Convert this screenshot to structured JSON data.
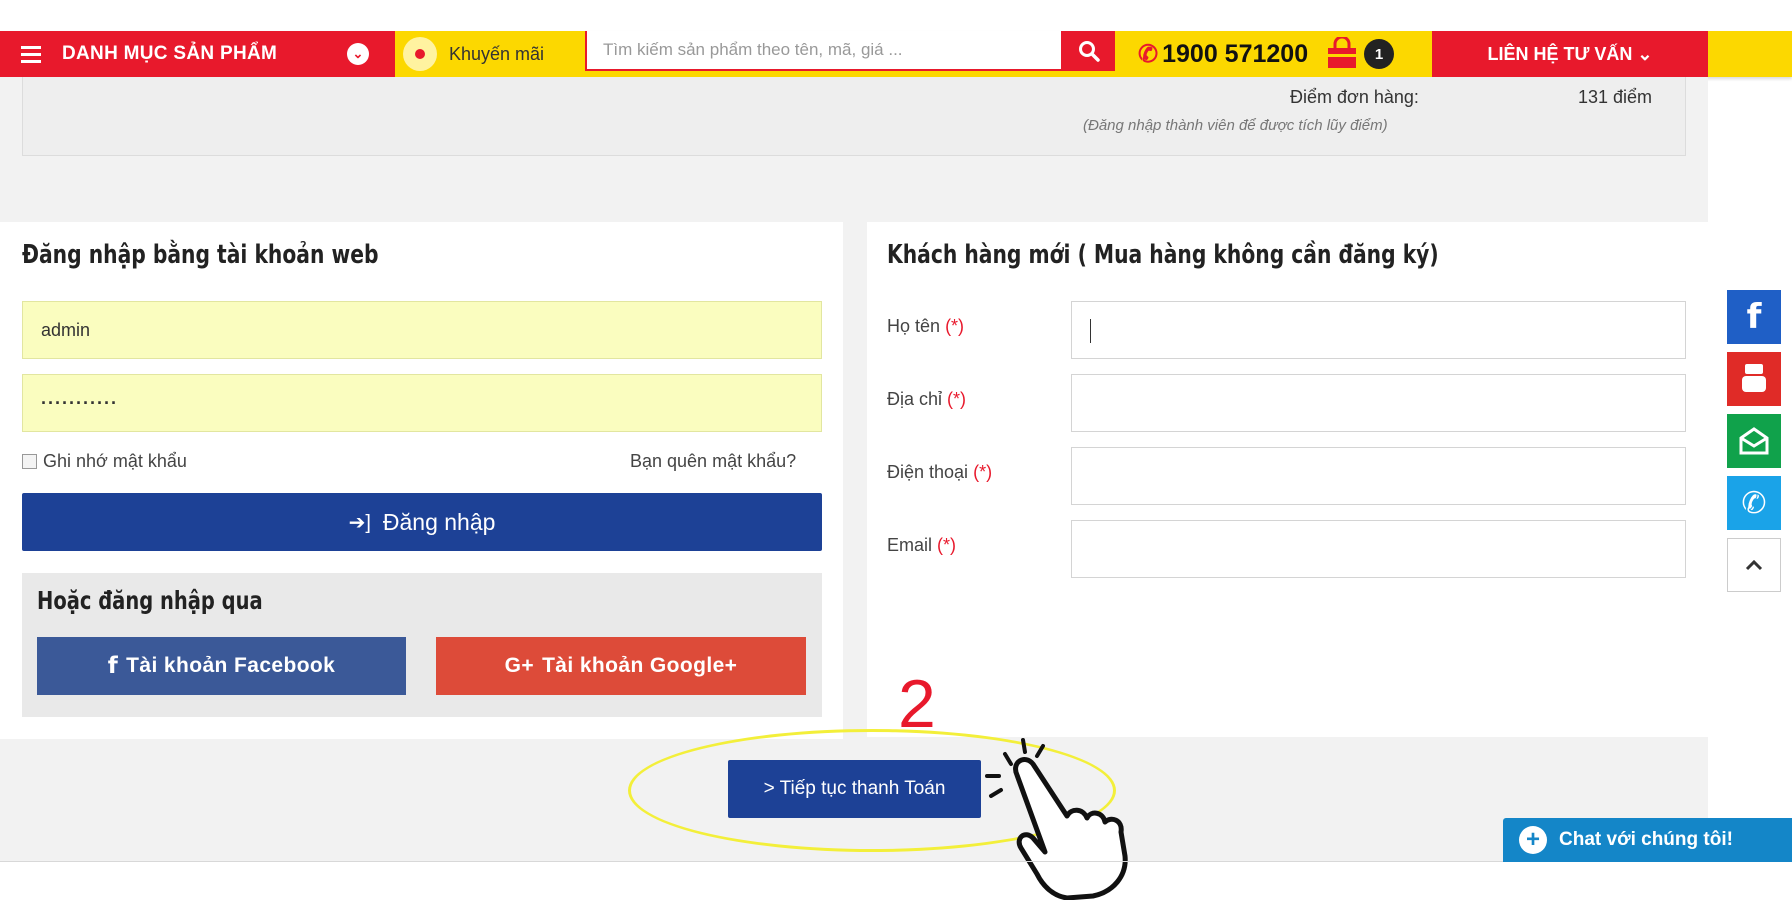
{
  "header": {
    "category_label": "DANH MỤC SẢN PHẨM",
    "promo_label": "Khuyến mãi",
    "search_placeholder": "Tìm kiếm sản phẩm theo tên, mã, giá ...",
    "phone": "1900 571200",
    "cart_count": "1",
    "contact_label": "LIÊN HỆ TƯ VẤN ⌄"
  },
  "points": {
    "label": "Điểm đơn hàng:",
    "value": "131 điểm",
    "note": "(Đăng nhập thành viên để được tích lũy điểm)"
  },
  "login": {
    "title": "Đăng nhập bằng tài khoản web",
    "username": "admin",
    "password": "···········",
    "remember_label": "Ghi nhớ mật khẩu",
    "forgot_label": "Bạn quên mật khẩu?",
    "login_button": "Đăng nhập",
    "alt_title": "Hoặc đăng nhập qua",
    "facebook_button": "Tài khoản Facebook",
    "google_button": "Tài khoản Google+"
  },
  "new_customer": {
    "title": "Khách hàng mới ( Mua hàng không cần đăng ký)",
    "required_mark": "(*)",
    "fields": [
      {
        "label": "Họ tên",
        "value": ""
      },
      {
        "label": "Địa chỉ",
        "value": ""
      },
      {
        "label": "Điện thoại",
        "value": ""
      },
      {
        "label": "Email",
        "value": ""
      }
    ]
  },
  "annotation": {
    "step_number": "2"
  },
  "checkout": {
    "continue_button": "> Tiếp tục thanh Toán"
  },
  "social": {
    "items": [
      {
        "icon": "facebook-icon",
        "color": "#1f5fc6"
      },
      {
        "icon": "youtube-icon",
        "color": "#e02b27"
      },
      {
        "icon": "email-icon",
        "color": "#10a24b"
      },
      {
        "icon": "phone-icon",
        "color": "#1aa3e8"
      },
      {
        "icon": "scroll-top-icon",
        "color": "#ffffff"
      }
    ]
  },
  "chat": {
    "label": "Chat với chúng tôi!"
  },
  "colors": {
    "brand_red": "#e8192c",
    "brand_yellow": "#fcd800",
    "primary_blue": "#1d4196",
    "facebook_blue": "#3b5998",
    "google_red": "#dd4b39",
    "input_yellow": "#fafdbf"
  }
}
